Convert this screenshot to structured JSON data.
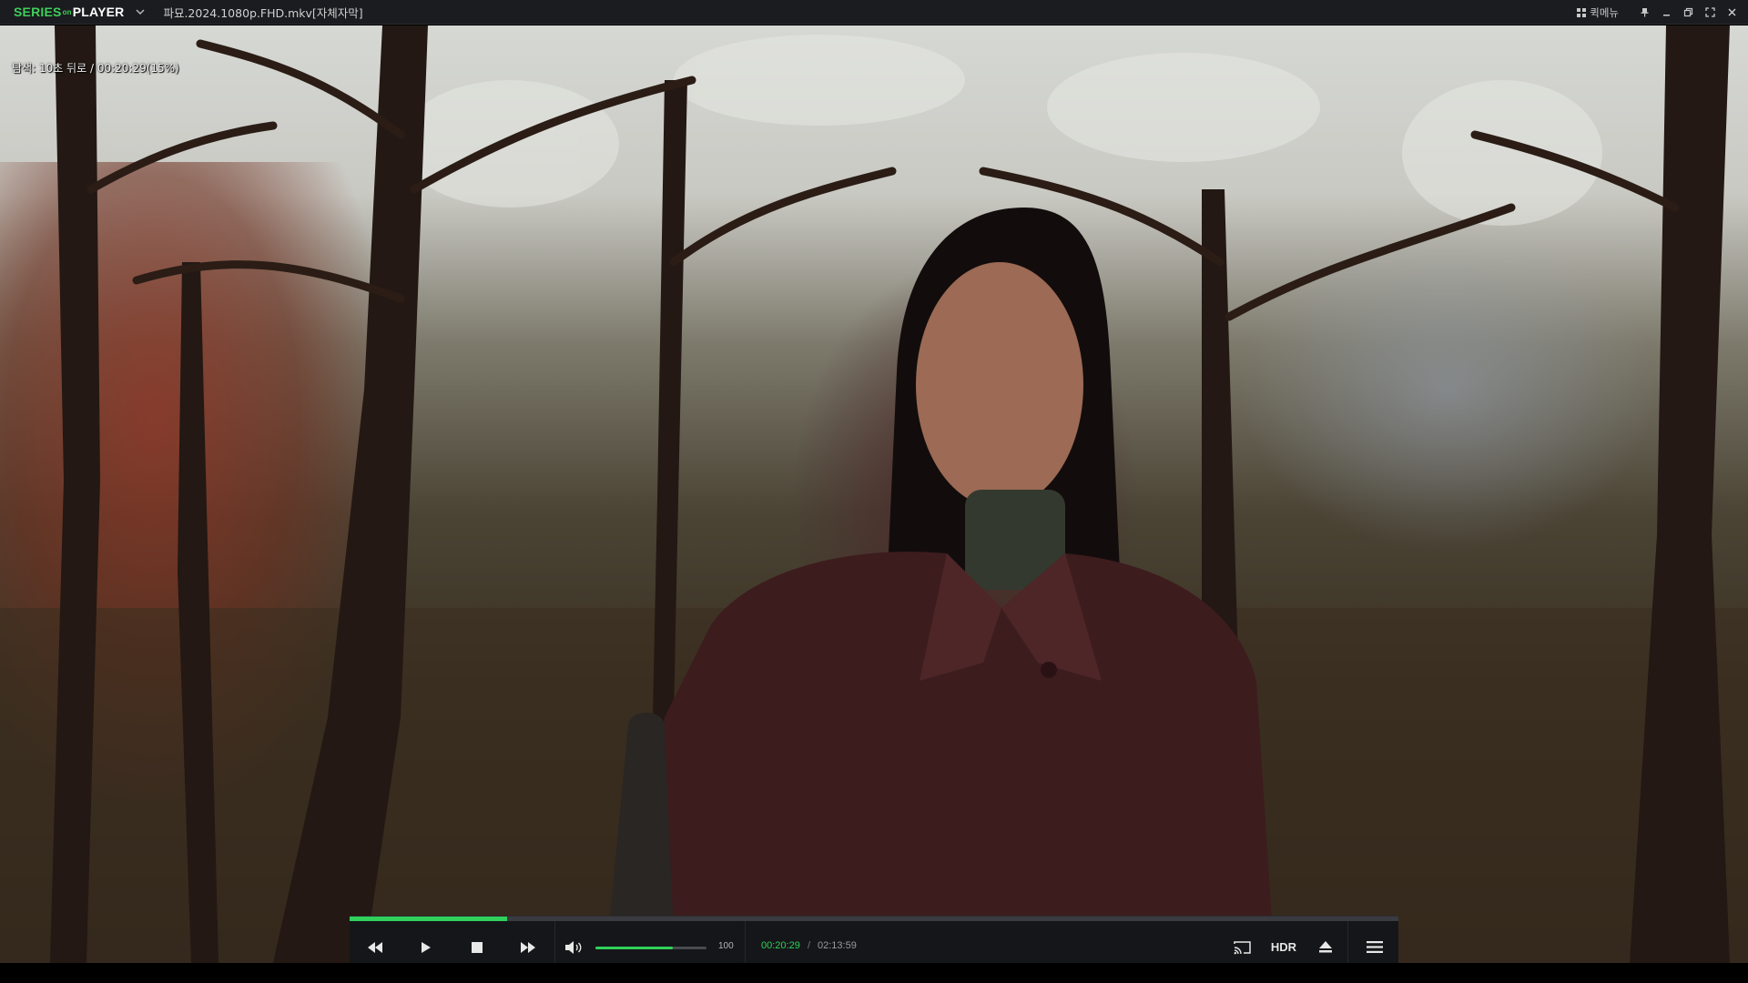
{
  "app": {
    "logo_series": "SERIES",
    "logo_on": "on",
    "logo_player": "PLAYER",
    "file_title": "파묘.2024.1080p.FHD.mkv[자체자막]",
    "quick_menu_label": "퀵메뉴"
  },
  "osd": {
    "message": "탐색: 10초 뒤로 / 00:20:29(15%)"
  },
  "playback": {
    "current_time": "00:20:29",
    "separator": "/",
    "duration": "02:13:59",
    "progress_percent": 15,
    "volume": 100,
    "volume_label": "100",
    "volume_fill_fraction": 0.7
  },
  "controls": {
    "hdr_label": "HDR"
  },
  "icons": {
    "logo_chevron": "chevron-down-icon",
    "quick_menu": "grid-icon",
    "pin": "pin-icon",
    "minimize": "minimize-icon",
    "restore": "restore-icon",
    "fullscreen": "fullscreen-icon",
    "close": "close-icon",
    "rewind": "rewind-icon",
    "play": "play-icon",
    "stop": "stop-icon",
    "fast_forward": "fast-forward-icon",
    "volume": "volume-icon",
    "cast": "cast-icon",
    "eject": "eject-icon",
    "menu": "menu-icon"
  },
  "colors": {
    "accent": "#2fd15b",
    "titlebar_bg": "#1b1c1f",
    "controlbar_bg": "#151619"
  }
}
